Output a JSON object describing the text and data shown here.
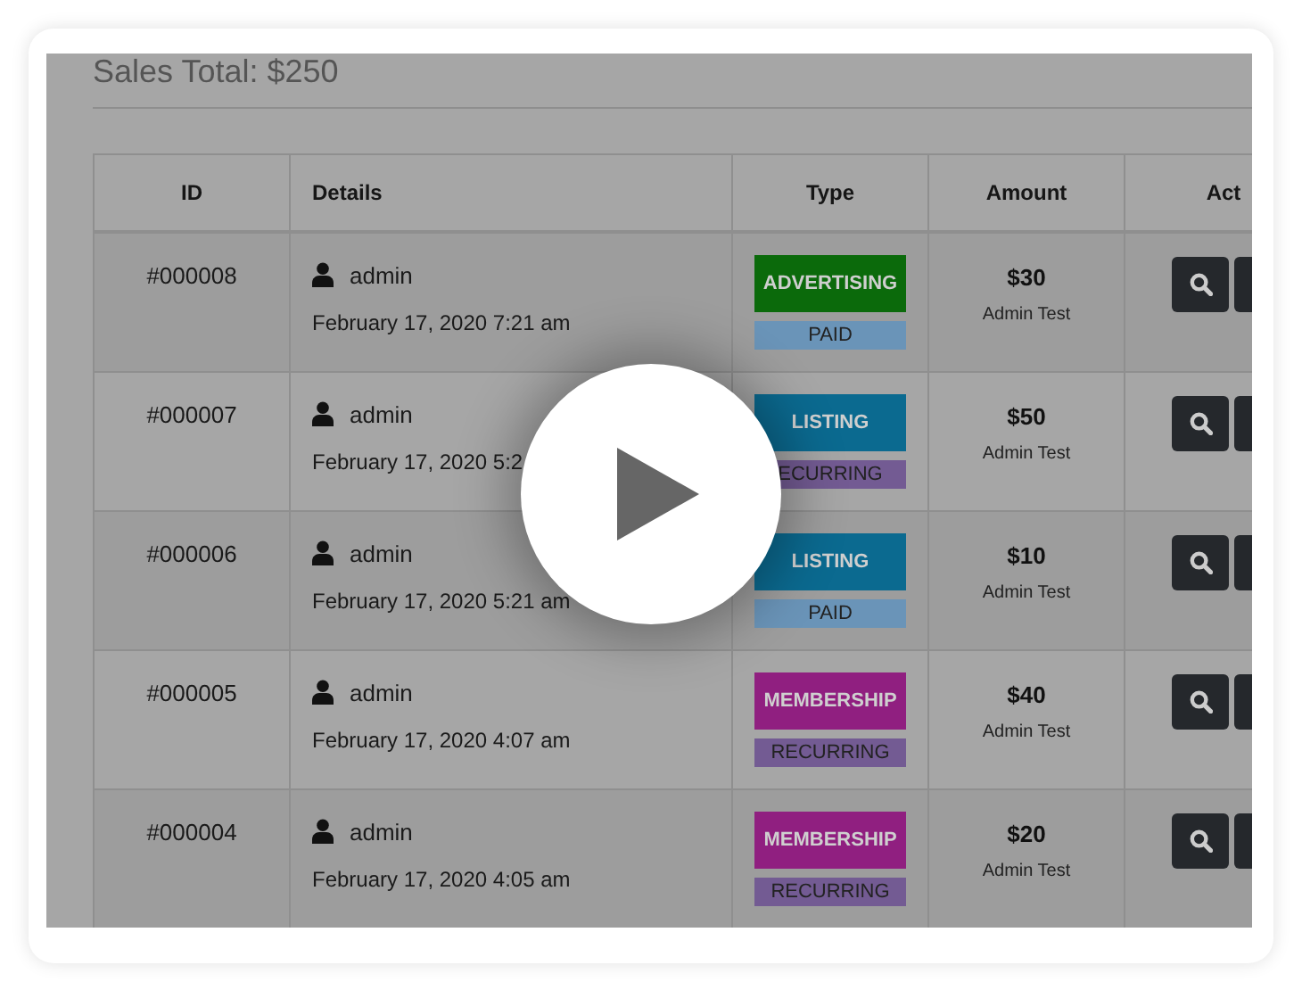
{
  "page": {
    "title": "Sales Total: $250"
  },
  "table": {
    "columns": [
      "ID",
      "Details",
      "Type",
      "Amount",
      "Act"
    ],
    "rows": [
      {
        "id": "#000008",
        "user": "admin",
        "date": "February 17, 2020 7:21 am",
        "type": {
          "label": "ADVERTISING",
          "color": "#0b6a0b"
        },
        "billing": {
          "label": "PAID",
          "color": "#6a94b8"
        },
        "amount": "$30",
        "note": "Admin Test"
      },
      {
        "id": "#000007",
        "user": "admin",
        "date": "February 17, 2020 5:2",
        "type": {
          "label": "LISTING",
          "color": "#0b6a90"
        },
        "billing": {
          "label": "ECURRING",
          "color": "#735b93"
        },
        "amount": "$50",
        "note": "Admin Test"
      },
      {
        "id": "#000006",
        "user": "admin",
        "date": "February 17, 2020 5:21 am",
        "type": {
          "label": "LISTING",
          "color": "#0b6a90"
        },
        "billing": {
          "label": "PAID",
          "color": "#6a94b8"
        },
        "amount": "$10",
        "note": "Admin Test"
      },
      {
        "id": "#000005",
        "user": "admin",
        "date": "February 17, 2020 4:07 am",
        "type": {
          "label": "MEMBERSHIP",
          "color": "#901f80"
        },
        "billing": {
          "label": "RECURRING",
          "color": "#735b93"
        },
        "amount": "$40",
        "note": "Admin Test"
      },
      {
        "id": "#000004",
        "user": "admin",
        "date": "February 17, 2020 4:05 am",
        "type": {
          "label": "MEMBERSHIP",
          "color": "#901f80"
        },
        "billing": {
          "label": "RECURRING",
          "color": "#735b93"
        },
        "amount": "$20",
        "note": "Admin Test"
      }
    ]
  }
}
